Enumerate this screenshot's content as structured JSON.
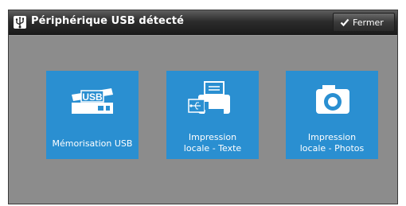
{
  "dialog": {
    "title": "Périphérique USB détecté",
    "title_icon": "usb-icon",
    "close_label": "Fermer",
    "close_icon": "checkmark-icon"
  },
  "tiles": [
    {
      "icon": "usb-storage-icon",
      "line1": "Mémorisation USB",
      "line2": ""
    },
    {
      "icon": "usb-print-text-icon",
      "line1": "Impression",
      "line2": "locale - Texte"
    },
    {
      "icon": "camera-icon",
      "line1": "Impression",
      "line2": "locale - Photos"
    }
  ],
  "colors": {
    "tile": "#2a8fd1",
    "background": "#8c8c8c",
    "titlebar": "#1a1a1a"
  }
}
